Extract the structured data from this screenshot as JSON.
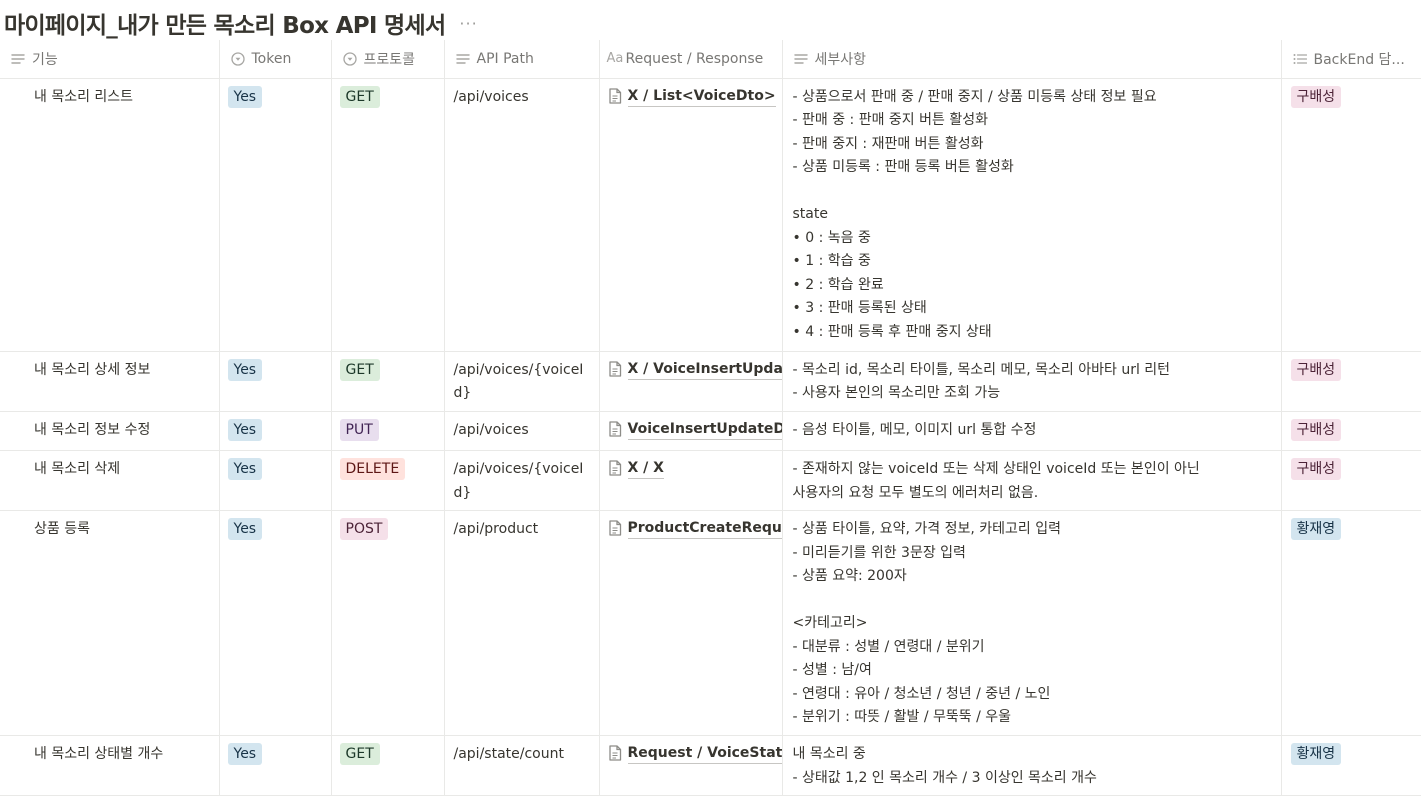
{
  "page": {
    "title": "마이페이지_내가 만든 목소리 Box API 명세서",
    "more": "···"
  },
  "columns": [
    {
      "label": "기능",
      "icon": "text-lines-icon"
    },
    {
      "label": "Token",
      "icon": "select-icon"
    },
    {
      "label": "프로토콜",
      "icon": "select-icon"
    },
    {
      "label": "API Path",
      "icon": "text-lines-icon"
    },
    {
      "label": "Request / Response",
      "icon": "aa-title-icon",
      "icon_text": "Aa"
    },
    {
      "label": "세부사항",
      "icon": "text-lines-icon"
    },
    {
      "label": "BackEnd 담...",
      "icon": "list-icon"
    }
  ],
  "rows": [
    {
      "feature": "내 목소리 리스트",
      "token": "Yes",
      "protocol": "GET",
      "path": "/api/voices",
      "req": "X / List<VoiceDto>",
      "detail": [
        "- 상품으로서 판매 중 / 판매 중지 / 상품 미등록 상태 정보 필요",
        "- 판매 중 : 판매 중지 버튼 활성화",
        "- 판매 중지 : 재판매 버튼 활성화",
        "- 상품 미등록 : 판매 등록 버튼 활성화",
        "",
        "state",
        "• 0 : 녹음 중",
        "• 1 : 학습 중",
        "• 2 : 학습 완료",
        "• 3 : 판매 등록된 상태",
        "• 4 : 판매 등록 후 판매 중지 상태"
      ],
      "owner": "구배성"
    },
    {
      "feature": "내 목소리 상세 정보",
      "token": "Yes",
      "protocol": "GET",
      "path": "/api/voices/{voiceId}",
      "req": "X / VoiceInsertUpdateDto",
      "detail": [
        "- 목소리 id, 목소리 타이틀, 목소리 메모, 목소리 아바타 url 리턴",
        "- 사용자 본인의 목소리만 조회 가능"
      ],
      "owner": "구배성"
    },
    {
      "feature": "내 목소리 정보 수정",
      "token": "Yes",
      "protocol": "PUT",
      "path": "/api/voices",
      "req": "VoiceInsertUpdateDto / X",
      "detail": [
        "- 음성 타이틀, 메모, 이미지 url 통합 수정"
      ],
      "owner": "구배성"
    },
    {
      "feature": "내 목소리 삭제",
      "token": "Yes",
      "protocol": "DELETE",
      "path": "/api/voices/{voiceId}",
      "req": "X / X",
      "detail": [
        "- 존재하지 않는 voiceId 또는 삭제 상태인 voiceId 또는 본인이 아닌",
        "사용자의 요청 모두 별도의 에러처리 없음."
      ],
      "owner": "구배성"
    },
    {
      "feature": "상품 등록",
      "token": "Yes",
      "protocol": "POST",
      "path": "/api/product",
      "req": "ProductCreateRequestDto / X",
      "detail": [
        "- 상품 타이틀, 요약, 가격 정보, 카테고리 입력",
        "- 미리듣기를 위한 3문장 입력",
        "- 상품 요약: 200자",
        "",
        "<카테고리>",
        "- 대분류 : 성별 / 연령대 / 분위기",
        "- 성별 : 남/여",
        "- 연령대 : 유아 / 청소년 / 청년 / 중년 / 노인",
        "- 분위기 : 따뜻 / 활발 / 무뚝뚝 / 우울"
      ],
      "owner": "황재영"
    },
    {
      "feature": "내 목소리 상태별 개수",
      "token": "Yes",
      "protocol": "GET",
      "path": "/api/state/count",
      "req": "Request / VoiceStateDto",
      "detail": [
        "내 목소리 중",
        "- 상태값 1,2 인 목소리 개수 / 3 이상인 목소리 개수"
      ],
      "owner": "황재영"
    }
  ],
  "colors": {
    "token_yes": "#d3e5ef",
    "GET": "#dbeddb",
    "PUT": "#e8deee",
    "DELETE": "#ffe2dd",
    "POST": "#f5e0e9",
    "구배성": "#f5e0e9",
    "황재영": "#d3e5ef"
  }
}
